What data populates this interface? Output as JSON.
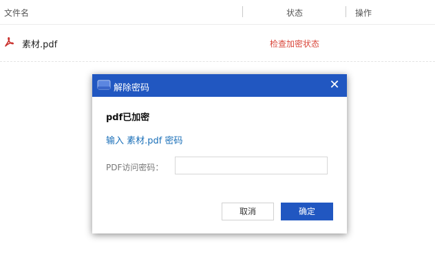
{
  "file_list": {
    "columns": {
      "name": "文件名",
      "status": "状态",
      "action": "操作"
    },
    "rows": [
      {
        "icon": "pdf-file-icon",
        "file_name": "素材.pdf",
        "action_link": "检查加密状态"
      }
    ]
  },
  "modal": {
    "title": "解除密码",
    "close_icon": "close-icon",
    "heading": "pdf已加密",
    "prompt": "输入 素材.pdf 密码",
    "password_label": "PDF访问密码：",
    "password_value": "",
    "password_placeholder": "",
    "cancel_label": "取消",
    "confirm_label": "确定"
  },
  "colors": {
    "accent_blue": "#2157c1",
    "link_red": "#d9463a",
    "prompt_blue": "#1a6fb8"
  }
}
